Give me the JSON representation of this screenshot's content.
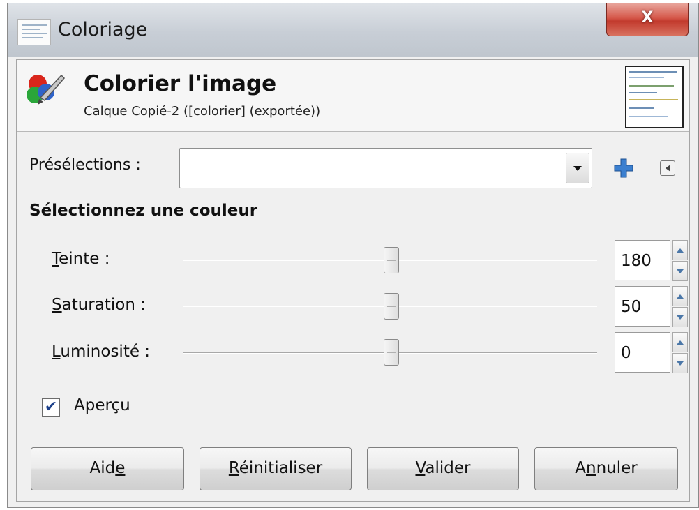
{
  "window": {
    "title": "Coloriage",
    "close_label": "X"
  },
  "header": {
    "title": "Colorier l'image",
    "subtitle": "Calque Copié-2 ([colorier] (exportée))"
  },
  "presets": {
    "label": "Présélections :",
    "value": ""
  },
  "section": {
    "heading": "Sélectionnez une couleur"
  },
  "sliders": [
    {
      "mnemonic": "T",
      "rest": "einte :",
      "value": "180",
      "position": 0.5
    },
    {
      "mnemonic": "S",
      "rest": "aturation :",
      "value": "50",
      "position": 0.5
    },
    {
      "mnemonic": "L",
      "rest": "uminosité :",
      "value": "0",
      "position": 0.5
    }
  ],
  "preview": {
    "label": "Aperçu",
    "checked": true,
    "check_glyph": "✔"
  },
  "buttons": {
    "help": {
      "pre": "Aid",
      "mnemonic": "e",
      "post": ""
    },
    "reset": {
      "pre": "",
      "mnemonic": "R",
      "post": "éinitialiser"
    },
    "ok": {
      "pre": "",
      "mnemonic": "V",
      "post": "alider"
    },
    "cancel": {
      "pre": "A",
      "mnemonic": "n",
      "post": "nuler"
    }
  },
  "icons": {
    "app": "document-icon",
    "colorize": "colorize-icon",
    "add": "plus-icon",
    "menu": "menu-arrow-icon",
    "dropdown": "chevron-down-icon"
  },
  "colors": {
    "accent": "#4b77a8",
    "close": "#c23a2d"
  }
}
